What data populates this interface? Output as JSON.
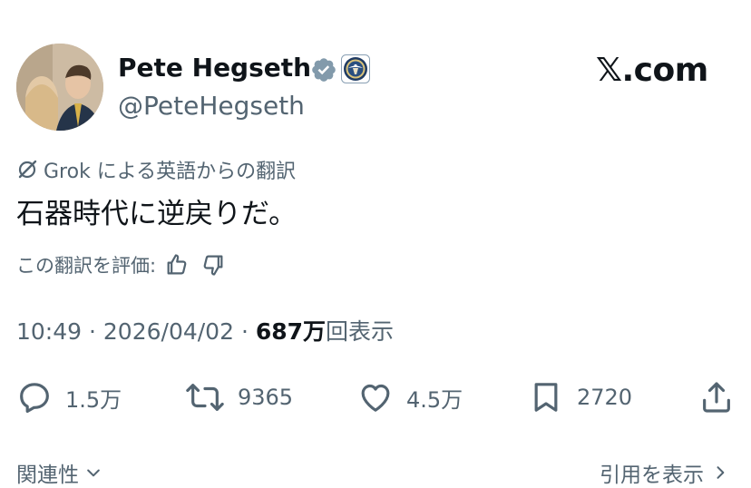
{
  "author": {
    "name": "Pete Hegseth",
    "handle": "@PeteHegseth"
  },
  "brand": "𝕏.com",
  "translation": {
    "source_label": "Grok による英語からの翻訳",
    "text": "石器時代に逆戻りだ。",
    "rate_label": "この翻訳を評価:"
  },
  "meta": {
    "time": "10:49",
    "date": "2026/04/02",
    "separator": "·",
    "views_number": "687万",
    "views_suffix": "回表示"
  },
  "actions": {
    "replies": "1.5万",
    "reposts": "9365",
    "likes": "4.5万",
    "bookmarks": "2720"
  },
  "footer": {
    "related": "関連性",
    "quotes": "引用を表示"
  },
  "colors": {
    "text": "#0f1419",
    "muted": "#536471",
    "verified_badge": "#829aab"
  },
  "icons": {
    "verified": "verified-badge-icon",
    "affiliate": "dod-seal-icon",
    "grok": "grok-icon",
    "thumb_up": "thumbs-up-icon",
    "thumb_down": "thumbs-down-icon",
    "reply": "reply-icon",
    "repost": "repost-icon",
    "like": "heart-icon",
    "bookmark": "bookmark-icon",
    "share": "share-icon",
    "chevron_down": "chevron-down-icon",
    "chevron_right": "chevron-right-icon"
  }
}
